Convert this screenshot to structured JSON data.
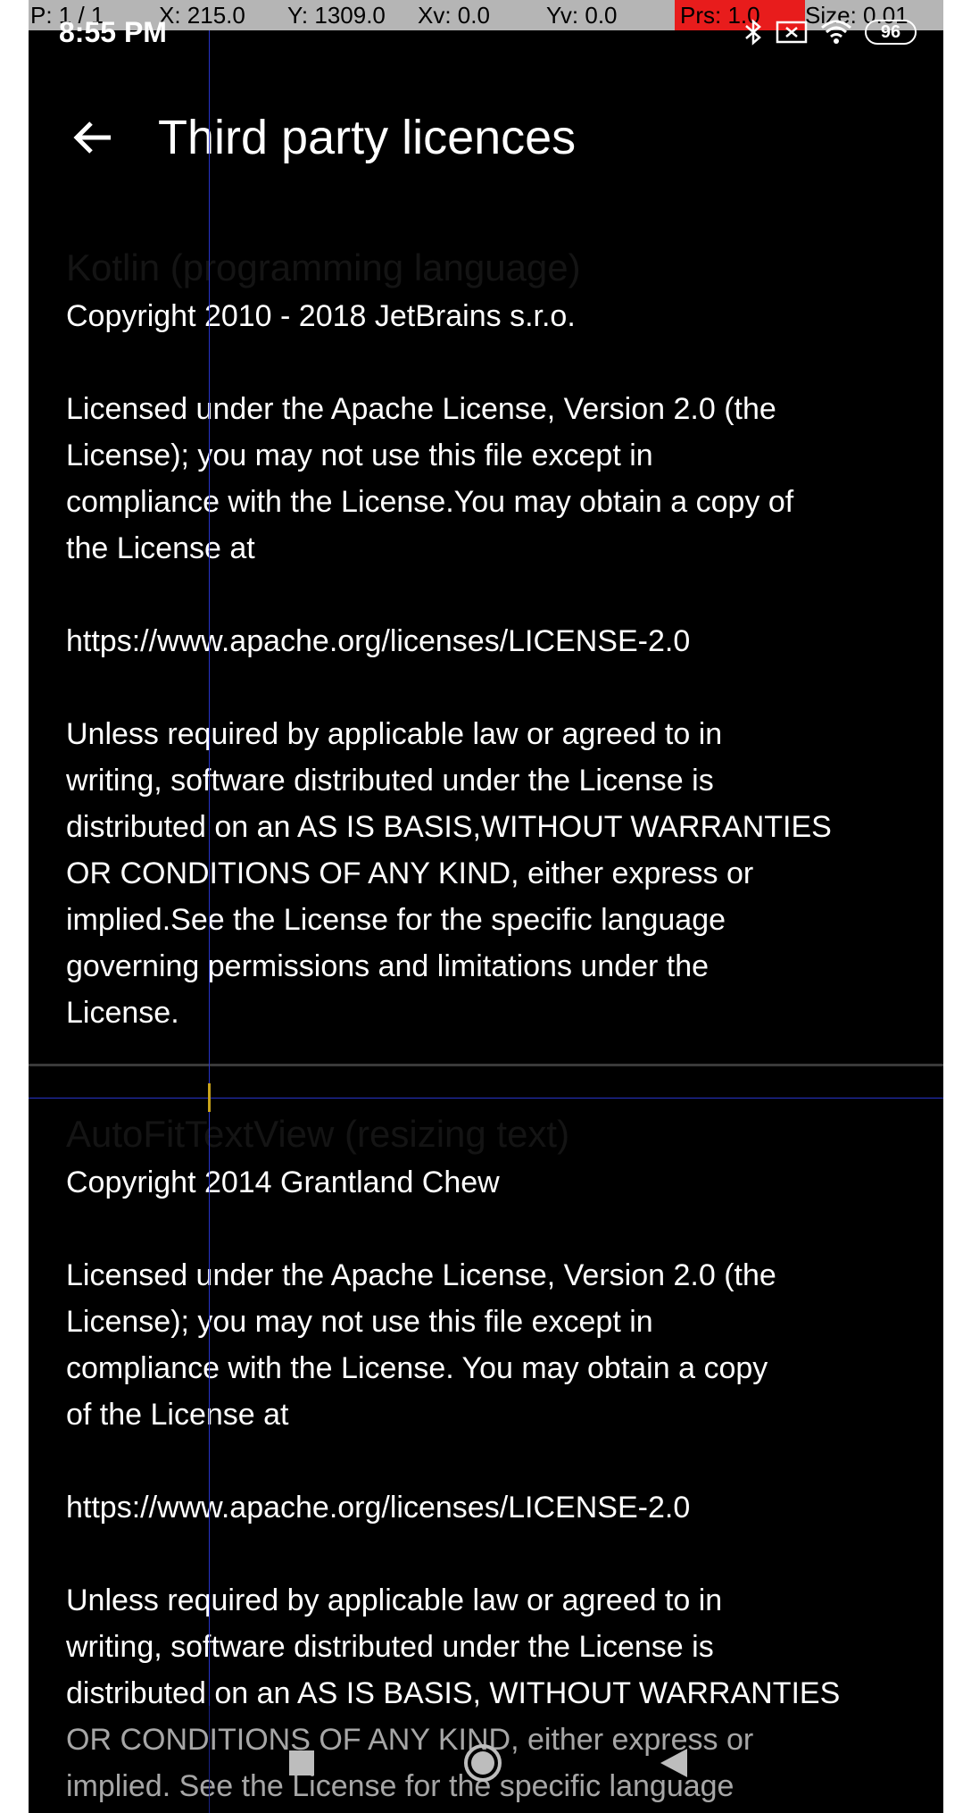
{
  "debug_bar": {
    "pointer": "P: 1 / 1",
    "x": "X: 215.0",
    "y": "Y: 1309.0",
    "xv": "Xv: 0.0",
    "yv": "Yv: 0.0",
    "prs": "Prs: 1.0",
    "size": "Size: 0.01"
  },
  "status_bar": {
    "time": "8:55 PM",
    "battery": "96",
    "icons": [
      "bluetooth-icon",
      "x-box-icon",
      "wifi-icon",
      "battery-icon"
    ]
  },
  "toolbar": {
    "title": "Third party licences",
    "back_icon": "arrow-left-icon"
  },
  "licences": [
    {
      "heading": "Kotlin (programming language)",
      "paragraphs": [
        [
          "Copyright 2010 - 2018 JetBrains s.r.o."
        ],
        [
          "Licensed under the Apache License, Version 2.0 (the",
          "License); you may not use this file except in",
          "compliance with the License.You may obtain a copy of",
          "the License at"
        ],
        [
          "https://www.apache.org/licenses/LICENSE-2.0"
        ],
        [
          "Unless required by applicable law or agreed to in",
          "writing, software distributed under the License is",
          "distributed on an AS IS BASIS,WITHOUT WARRANTIES",
          "OR CONDITIONS OF ANY KIND, either express or",
          "implied.See the License for the specific language",
          "governing permissions and limitations under the",
          "License."
        ]
      ]
    },
    {
      "heading": "AutoFitTextView (resizing text)",
      "paragraphs": [
        [
          "Copyright 2014 Grantland Chew"
        ],
        [
          "Licensed under the Apache License, Version 2.0 (the",
          "License); you may not use this file except in",
          "compliance with the License. You may obtain a copy",
          "of the License at"
        ],
        [
          "https://www.apache.org/licenses/LICENSE-2.0"
        ],
        [
          "Unless required by applicable law or agreed to in",
          "writing, software distributed under the License is",
          "distributed on an AS IS BASIS, WITHOUT WARRANTIES",
          "OR CONDITIONS OF ANY KIND, either express or",
          "implied. See the License for the specific language"
        ]
      ]
    }
  ],
  "nav_bar": {
    "icons": [
      "recent-apps-icon",
      "home-icon",
      "back-triangle-icon"
    ]
  }
}
